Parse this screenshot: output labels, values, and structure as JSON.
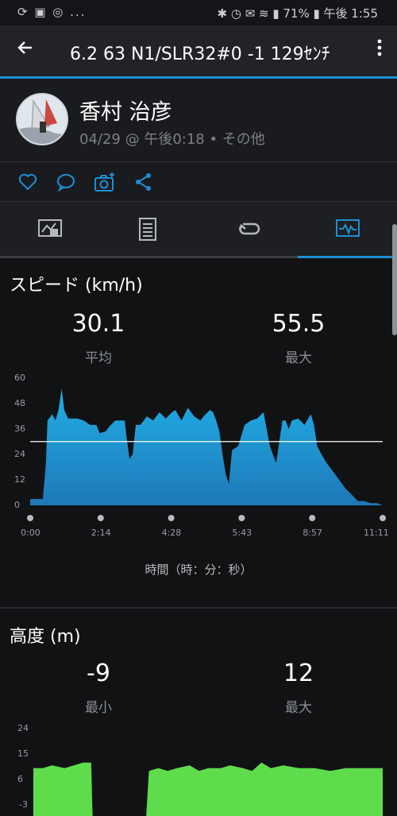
{
  "status_bar": {
    "left_icons": "⟳ ▣ ◎ ...",
    "right_text": "✱ ◷ ✉ ≋ ▮ 71% ▮ 午後 1:55"
  },
  "header": {
    "title": "6.2 63 N1/SLR32#0 -1 129ｾﾝﾁ"
  },
  "profile": {
    "name": "香村 治彦",
    "meta": "04/29 @ 午後0:18 • その他"
  },
  "speed": {
    "title": "スピード (km/h)",
    "stats": [
      {
        "value": "30.1",
        "label": "平均"
      },
      {
        "value": "55.5",
        "label": "最大"
      }
    ],
    "x_caption": "時間（時：分：秒）",
    "chart_data": {
      "type": "area",
      "ylim": [
        0,
        60
      ],
      "yticks": [
        "60",
        "48",
        "36",
        "24",
        "12",
        "0"
      ],
      "xticks": [
        "0:00",
        "2:14",
        "4:28",
        "5:43",
        "8:57",
        "11:11"
      ],
      "average": 30.1,
      "x": [
        0,
        0.2,
        0.25,
        0.35,
        0.4,
        0.5,
        0.55,
        0.6,
        0.7,
        0.8,
        0.9,
        1.0,
        1.08,
        1.2,
        1.3,
        1.5,
        1.7,
        1.9,
        2.1,
        2.2,
        2.4,
        2.5,
        2.7,
        2.9,
        3.0,
        3.05,
        3.15,
        3.25,
        3.35,
        3.5,
        3.7,
        3.9,
        4.1,
        4.3,
        4.5,
        4.6,
        4.8,
        5.0,
        5.2,
        5.4,
        5.5,
        5.7,
        5.8,
        5.9,
        6.0,
        6.1,
        6.2,
        6.3,
        6.4,
        6.6,
        6.8,
        7.0,
        7.2,
        7.4,
        7.6,
        7.8,
        8.0,
        8.1,
        8.2,
        8.3,
        8.5,
        8.7,
        8.9,
        9.0,
        9.1,
        9.2,
        9.4,
        9.6,
        9.8,
        10.0,
        10.2,
        10.4,
        10.6,
        10.8,
        11.0,
        11.18
      ],
      "y": [
        3,
        3,
        3,
        3,
        3,
        20,
        40,
        41,
        43,
        40,
        45,
        55,
        45,
        41,
        41,
        41,
        40,
        38,
        38,
        34,
        35,
        37,
        40,
        40,
        40,
        33,
        22,
        24,
        38,
        38,
        42,
        40,
        44,
        41,
        44,
        45,
        40,
        46,
        42,
        40,
        42,
        45,
        44,
        40,
        35,
        24,
        15,
        10,
        26,
        28,
        38,
        40,
        41,
        44,
        28,
        20,
        40,
        40,
        36,
        40,
        41,
        38,
        43,
        38,
        28,
        25,
        20,
        16,
        12,
        8,
        5,
        2,
        2,
        1,
        1,
        0
      ]
    }
  },
  "altitude": {
    "title": "高度 (m)",
    "stats": [
      {
        "value": "-9",
        "label": "最小"
      },
      {
        "value": "12",
        "label": "最大"
      }
    ],
    "chart_data": {
      "type": "area",
      "ylim": [
        -3,
        24
      ],
      "yticks": [
        "24",
        "15",
        "6",
        "-3"
      ],
      "x": [
        0,
        0.3,
        0.6,
        1.0,
        1.3,
        1.6,
        1.85,
        1.9,
        2.2,
        2.6,
        3.0,
        3.3,
        3.6,
        3.7,
        4.0,
        4.3,
        4.6,
        5.0,
        5.3,
        5.6,
        6.0,
        6.3,
        6.7,
        7.0,
        7.3,
        7.6,
        8.0,
        8.5,
        9.0,
        9.5,
        10.0,
        10.5,
        11.18
      ],
      "y": [
        10,
        10,
        11,
        10,
        11,
        12,
        12,
        -9,
        -9,
        -8,
        -9,
        -8,
        -9,
        9,
        10,
        9,
        10,
        11,
        9,
        10,
        10,
        11,
        10,
        9,
        12,
        10,
        11,
        10,
        10,
        9,
        10,
        10,
        10
      ]
    }
  },
  "colors": {
    "accent": "#1e8fd2",
    "speed_fill_top": "#21aee6",
    "speed_fill_bottom": "#1e78b8",
    "altitude_fill": "#5fdc4c"
  }
}
